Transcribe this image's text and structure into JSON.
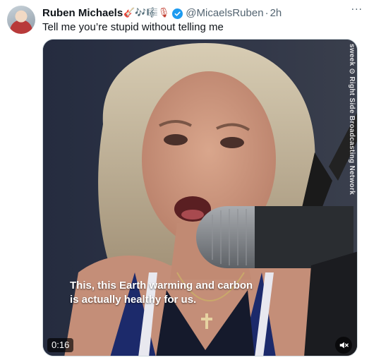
{
  "tweet": {
    "author_name": "Ruben Michaels",
    "author_emojis": "🎸🎶🎼🎙",
    "handle": "@MicaelsRuben",
    "separator": "·",
    "time": "2h",
    "more_label": "···",
    "text": "Tell me you’re stupid without telling me"
  },
  "media": {
    "watermark": "sweek  ⊙ Right Side Broadcasting Network",
    "caption": "This, this Earth warming and carbon is actually healthy for us.",
    "duration": "0:16"
  },
  "icons": {
    "verified": "verified-badge-icon",
    "mute": "speaker-muted-icon",
    "more": "more-icon"
  },
  "colors": {
    "accent": "#1d9bf0",
    "text_primary": "#0f1419",
    "text_secondary": "#536471"
  }
}
